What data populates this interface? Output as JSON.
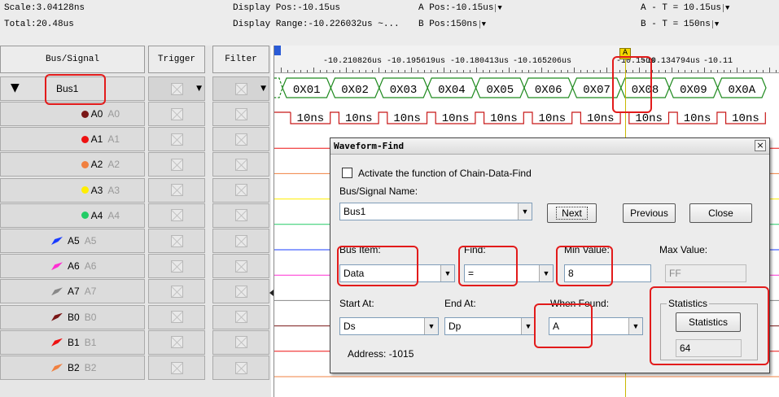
{
  "topbar": {
    "scale": "Scale:3.04128ns",
    "total": "Total:20.48us",
    "display_pos": "Display Pos:-10.15us",
    "display_range": "Display Range:-10.226032us ~...",
    "a_pos": "A Pos:-10.15us",
    "b_pos": "B Pos:150ns",
    "a_minus_t": "A - T = 10.15us",
    "b_minus_t": "B - T = 150ns"
  },
  "table": {
    "headers": {
      "signal": "Bus/Signal",
      "trigger": "Trigger",
      "filter": "Filter"
    },
    "bus_name": "Bus1",
    "signals": [
      {
        "name": "A0",
        "alias": "A0",
        "color": "#7a1616",
        "icon": "dot"
      },
      {
        "name": "A1",
        "alias": "A1",
        "color": "#ee1111",
        "icon": "dot"
      },
      {
        "name": "A2",
        "alias": "A2",
        "color": "#f08040",
        "icon": "dot"
      },
      {
        "name": "A3",
        "alias": "A3",
        "color": "#ffee00",
        "icon": "dot"
      },
      {
        "name": "A4",
        "alias": "A4",
        "color": "#22cc66",
        "icon": "dot"
      },
      {
        "name": "A5",
        "alias": "A5",
        "color": "#1a3cff",
        "icon": "pen"
      },
      {
        "name": "A6",
        "alias": "A6",
        "color": "#ff2fd2",
        "icon": "pen"
      },
      {
        "name": "A7",
        "alias": "A7",
        "color": "#888888",
        "icon": "pen"
      },
      {
        "name": "B0",
        "alias": "B0",
        "color": "#7a1616",
        "icon": "pen"
      },
      {
        "name": "B1",
        "alias": "B1",
        "color": "#ee1111",
        "icon": "pen"
      },
      {
        "name": "B2",
        "alias": "B2",
        "color": "#f08040",
        "icon": "pen"
      }
    ]
  },
  "ruler": {
    "ticks": [
      "-10.210826us",
      "-10.195619us",
      "-10.180413us",
      "-10.165206us",
      "-10.15us",
      "-10.134794us",
      "-10.11"
    ],
    "cursor_label": "A"
  },
  "bus_values": [
    "0X01",
    "0X02",
    "0X03",
    "0X04",
    "0X05",
    "0X06",
    "0X07",
    "0X08",
    "0X09",
    "0X0A"
  ],
  "pulse_label": "10ns",
  "pulse_count": 10,
  "dialog": {
    "title": "Waveform-Find",
    "chain_checkbox_label": "Activate the function of Chain-Data-Find",
    "bus_signal_label": "Bus/Signal Name:",
    "bus_signal_value": "Bus1",
    "next_label": "Next",
    "previous_label": "Previous",
    "close_label": "Close",
    "bus_item_label": "Bus Item:",
    "bus_item_value": "Data",
    "find_label": "Find:",
    "find_value": "=",
    "min_value_label": "Min Value:",
    "min_value": "8",
    "max_value_label": "Max Value:",
    "max_value": "FF",
    "start_at_label": "Start At:",
    "start_at_value": "Ds",
    "end_at_label": "End At:",
    "end_at_value": "Dp",
    "when_found_label": "When Found:",
    "when_found_value": "A",
    "statistics_group_label": "Statistics",
    "statistics_button_label": "Statistics",
    "statistics_value": "64",
    "address_text": "Address: -1015"
  },
  "colors": {
    "highlight": "#e21b1b",
    "bus_wave": "#1f8a1f",
    "pulse_wave": "#c81818"
  }
}
